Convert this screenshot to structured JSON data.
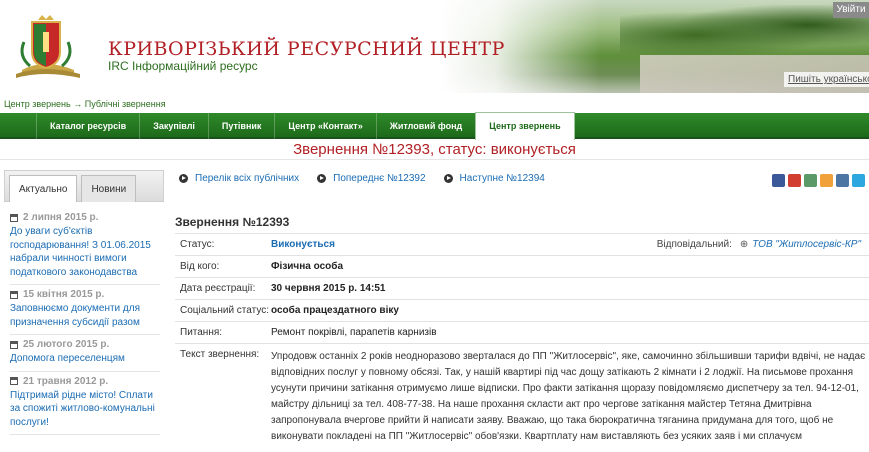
{
  "header": {
    "title": "КРИВОРІЗЬКИЙ РЕСУРСНИЙ ЦЕНТР",
    "subtitle": "IRC Інформаційний ресурс",
    "login_label": "Увійти",
    "lang_label": "Пишіть українською"
  },
  "breadcrumb": {
    "home": "Центр звернень",
    "separator": "→",
    "current": "Публічні звернення"
  },
  "nav": {
    "items": [
      {
        "label": "Каталог ресурсів"
      },
      {
        "label": "Закупівлі"
      },
      {
        "label": "Путівник"
      },
      {
        "label": "Центр «Контакт»"
      },
      {
        "label": "Житловий фонд"
      },
      {
        "label": "Центр звернень"
      }
    ]
  },
  "page_heading": "Звернення №12393, статус: виконується",
  "sidebar": {
    "tabs": [
      {
        "label": "Актуально"
      },
      {
        "label": "Новини"
      }
    ],
    "news": [
      {
        "date": "2 липня 2015 р.",
        "title": "До уваги суб'єктів господарювання! З 01.06.2015 набрали чинності вимоги податкового законодавства"
      },
      {
        "date": "15 квітня 2015 р.",
        "title": "Заповнюємо документи для призначення субсидії разом"
      },
      {
        "date": "25 лютого 2015 р.",
        "title": "Допомога переселенцям"
      },
      {
        "date": "21 травня 2012 р.",
        "title": "Підтримай рідне місто! Сплати за спожиті житлово-комунальні послуги!"
      }
    ]
  },
  "pager": {
    "list": "Перелік всіх публічних",
    "prev": "Попереднє №12392",
    "next": "Наступне №12394"
  },
  "request": {
    "title": "Звернення №12393",
    "status_label": "Статус:",
    "status_value": "Виконується",
    "responsible_label": "Відповідальний:",
    "responsible_value": "ТОВ \"Житлосервіс-КР\"",
    "from_label": "Від кого:",
    "from_value": "Фізична особа",
    "date_label": "Дата реєстрації:",
    "date_value": "30 червня 2015 р. 14:51",
    "social_label": "Соціальний статус:",
    "social_value": "особа працездатного віку",
    "question_label": "Питання:",
    "question_value": "Ремонт покрівлі, парапетів карнизів",
    "text_label": "Текст звернення:",
    "text_value": "Упродовж останніх 2 років неодноразово зверталася до ПП \"Житлосервіс\", яке, самочинно збільшивши тарифи вдвічі, не надає відповідних послуг у повному обсязі. Так, у нашій квартирі під час дощу затікають 2 кімнати і 2 лоджії. На письмове прохання усунути причини затікання отримуємо лише відписки. Про факти затікання щоразу повідомляємо диспетчеру за тел. 94-12-01, майстру дільниці за тел. 408-77-38. На наше прохання скласти акт про чергове затікання майстер Тетяна Дмитрівна запропонувала вчергове прийти й написати заяву. Вважаю, що така бюрократична тяганина придумана для того, щоб не виконувати покладені на ПП \"Житлосервіс\" обов'язки. Квартплату нам виставляють без усяких заяв і ми сплачуєм"
  },
  "colors": {
    "brand_red": "#b12025",
    "nav_green": "#1d6a1a",
    "link_blue": "#1b6cb3"
  }
}
